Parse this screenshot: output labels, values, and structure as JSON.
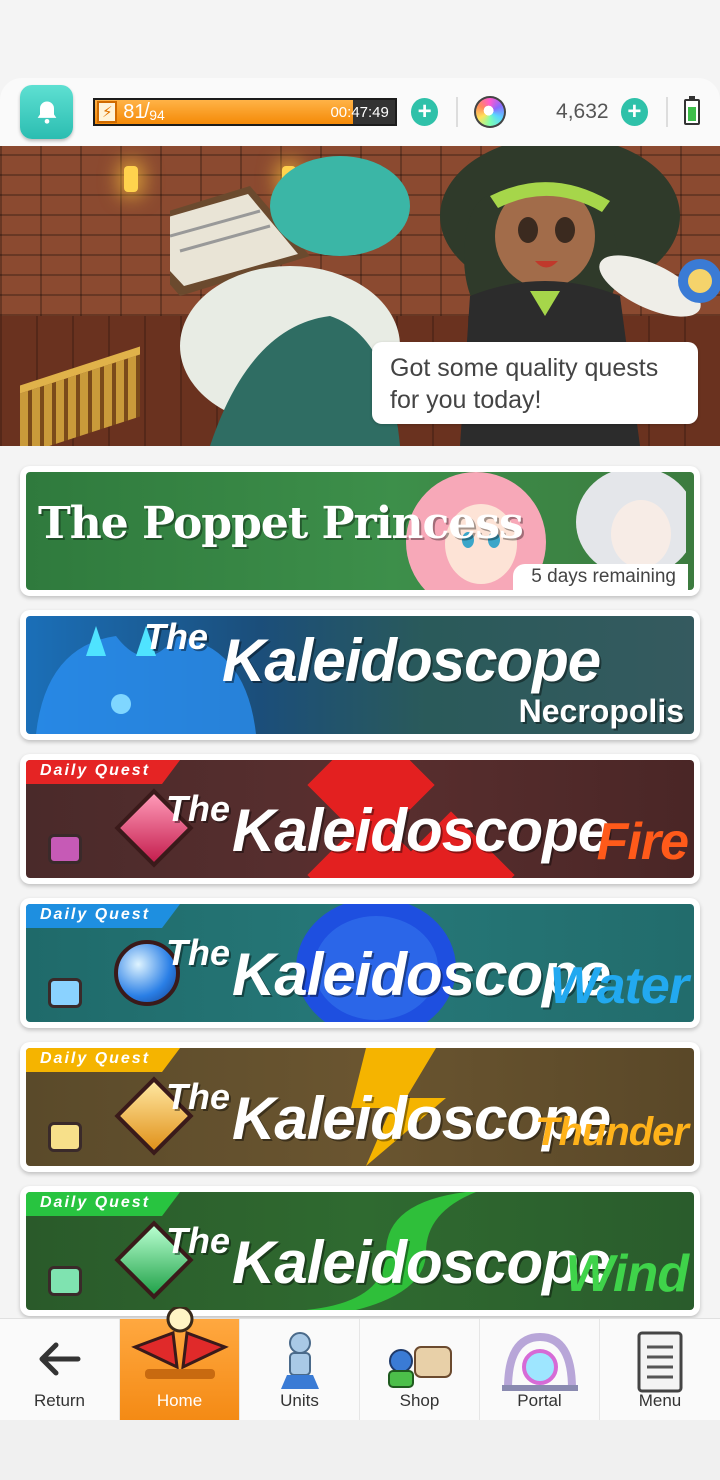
{
  "status": {
    "stamina_current": "81",
    "stamina_max": "94",
    "stamina_fraction": 0.86,
    "stamina_timer": "00:47:49",
    "gems": "4,632"
  },
  "hero": {
    "speech": "Got some quality quests for you today!"
  },
  "banners": [
    {
      "title": "The Poppet Princess",
      "remaining": "5 days remaining"
    },
    {
      "the": "The",
      "main": "Kaleidoscope",
      "sub": "Necropolis"
    },
    {
      "ribbon": "Daily Quest",
      "the": "The",
      "main": "Kaleidoscope",
      "element": "Fire",
      "color": "#e52424",
      "elem_color": "#ff6a1a"
    },
    {
      "ribbon": "Daily Quest",
      "the": "The",
      "main": "Kaleidoscope",
      "element": "Water",
      "color": "#1e8fe0",
      "elem_color": "#29a8ef"
    },
    {
      "ribbon": "Daily Quest",
      "the": "The",
      "main": "Kaleidoscope",
      "element": "Thunder",
      "color": "#f5b400",
      "elem_color": "#ffb21a"
    },
    {
      "ribbon": "Daily Quest",
      "the": "The",
      "main": "Kaleidoscope",
      "element": "Wind",
      "color": "#28c440",
      "elem_color": "#3fd34a"
    }
  ],
  "nav": {
    "return": "Return",
    "home": "Home",
    "units": "Units",
    "shop": "Shop",
    "portal": "Portal",
    "menu": "Menu"
  },
  "colors": {
    "accent": "#f48a14",
    "teal": "#2fc1a9"
  }
}
